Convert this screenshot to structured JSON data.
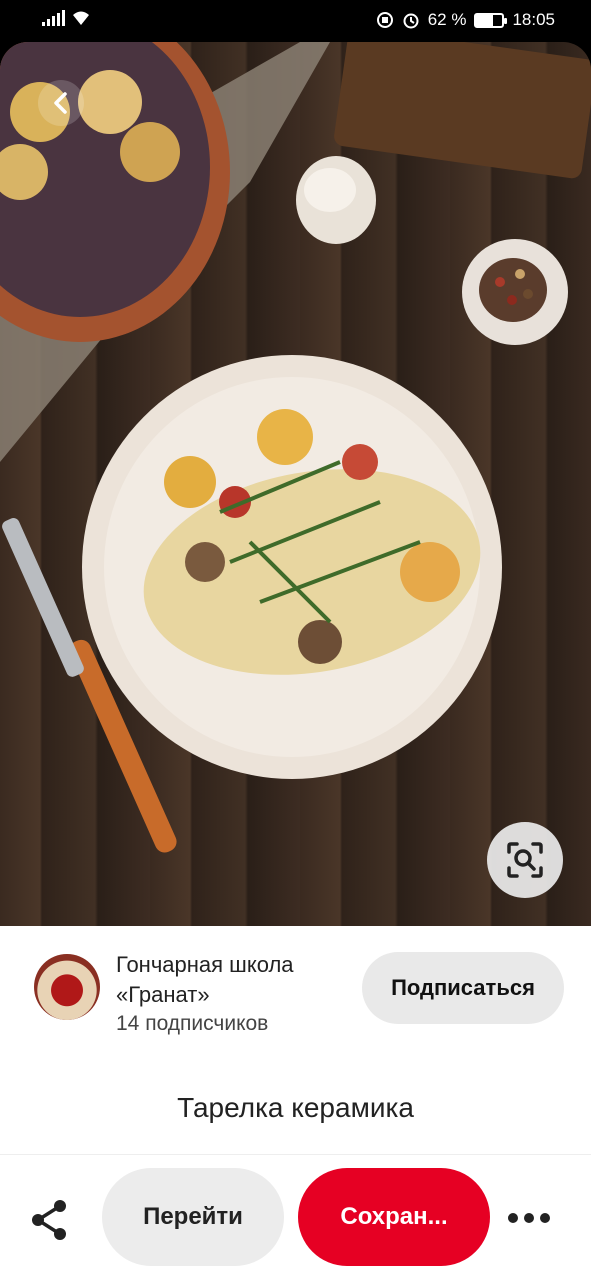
{
  "status": {
    "battery_text": "62 %",
    "battery_level": 0.62,
    "time": "18:05"
  },
  "pin": {
    "title": "Тарелка керамика",
    "image_icon": "food-photo"
  },
  "creator": {
    "name": "Гончарная школа «Гранат»",
    "followers": "14 подписчиков",
    "subscribe_label": "Подписаться"
  },
  "actions": {
    "share_icon": "share-icon",
    "visit_label": "Перейти",
    "save_label": "Сохран...",
    "more_icon": "more-icon"
  },
  "colors": {
    "save_red": "#e60023",
    "neutral_button": "#ececec"
  }
}
